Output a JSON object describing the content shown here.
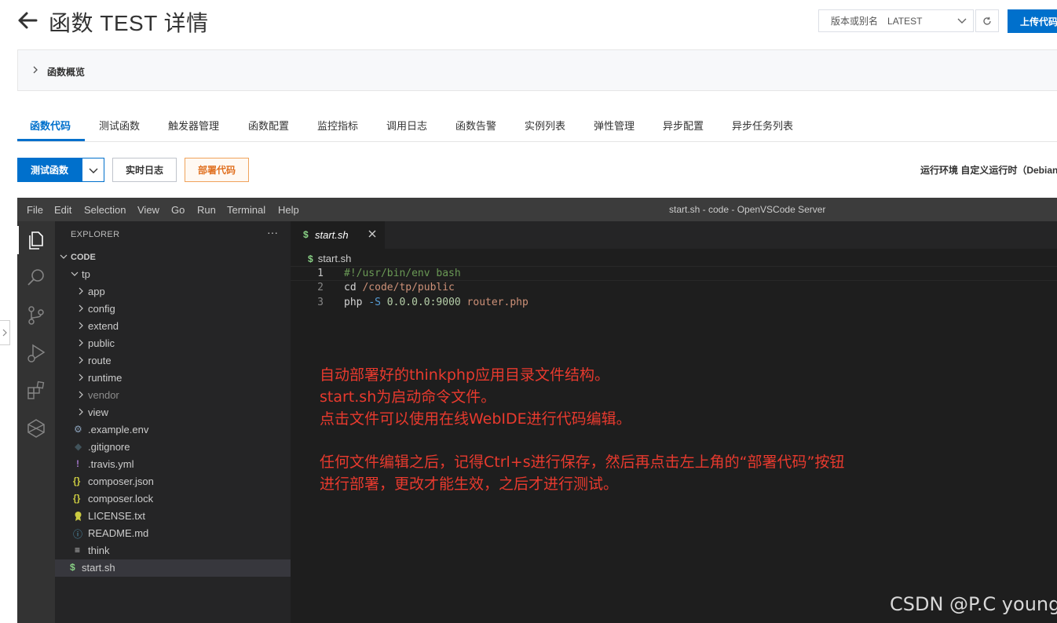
{
  "header": {
    "title": "函数 TEST 详情",
    "version_label": "版本或别名",
    "version_value": "LATEST",
    "upload_label": "上传代码"
  },
  "overview": {
    "label": "函数概览"
  },
  "tabs": [
    {
      "label": "函数代码",
      "active": true
    },
    {
      "label": "测试函数"
    },
    {
      "label": "触发器管理"
    },
    {
      "label": "函数配置"
    },
    {
      "label": "监控指标"
    },
    {
      "label": "调用日志"
    },
    {
      "label": "函数告警"
    },
    {
      "label": "实例列表"
    },
    {
      "label": "弹性管理"
    },
    {
      "label": "异步配置"
    },
    {
      "label": "异步任务列表"
    }
  ],
  "actions": {
    "test_label": "测试函数",
    "log_label": "实时日志",
    "deploy_label": "部署代码",
    "runtime_text": "运行环境 自定义运行时（Debian"
  },
  "ide": {
    "menu": [
      "File",
      "Edit",
      "Selection",
      "View",
      "Go",
      "Run",
      "Terminal",
      "Help"
    ],
    "window_title": "start.sh - code - OpenVSCode Server",
    "explorer_title": "EXPLORER",
    "explorer_more": "···",
    "root_folder": "CODE",
    "tree": [
      {
        "label": "tp",
        "kind": "folder-open",
        "depth": 1
      },
      {
        "label": "app",
        "kind": "folder",
        "depth": 2
      },
      {
        "label": "config",
        "kind": "folder",
        "depth": 2
      },
      {
        "label": "extend",
        "kind": "folder",
        "depth": 2
      },
      {
        "label": "public",
        "kind": "folder",
        "depth": 2
      },
      {
        "label": "route",
        "kind": "folder",
        "depth": 2
      },
      {
        "label": "runtime",
        "kind": "folder",
        "depth": 2
      },
      {
        "label": "vendor",
        "kind": "folder",
        "depth": 2,
        "dim": true
      },
      {
        "label": "view",
        "kind": "folder",
        "depth": 2
      },
      {
        "label": ".example.env",
        "kind": "gear",
        "depth": 2
      },
      {
        "label": ".gitignore",
        "kind": "git",
        "depth": 2
      },
      {
        "label": ".travis.yml",
        "kind": "bang",
        "depth": 2
      },
      {
        "label": "composer.json",
        "kind": "braces",
        "depth": 2
      },
      {
        "label": "composer.lock",
        "kind": "braces",
        "depth": 2
      },
      {
        "label": "LICENSE.txt",
        "kind": "license",
        "depth": 2
      },
      {
        "label": "README.md",
        "kind": "info",
        "depth": 2
      },
      {
        "label": "think",
        "kind": "lines",
        "depth": 2
      },
      {
        "label": "start.sh",
        "kind": "dollar",
        "depth": 1,
        "selected": true
      }
    ],
    "tab_name": "start.sh",
    "breadcrumb": "start.sh",
    "code_lines": [
      "#!/usr/bin/env bash",
      "cd /code/tp/public",
      "php -S 0.0.0.0:9000 router.php"
    ],
    "annotations": [
      "自动部署好的thinkphp应用目录文件结构。",
      "start.sh为启动命令文件。",
      "点击文件可以使用在线WebIDE进行代码编辑。",
      "任何文件编辑之后，记得Ctrl+s进行保存，然后再点击左上角的“部署代码”按钮",
      "进行部署，更改才能生效，之后才进行测试。"
    ]
  },
  "watermark": "CSDN @P.C young",
  "colors": {
    "accent": "#0070cc",
    "deploy": "#e07020",
    "annotation": "#e83a2e",
    "ide_bg": "#1e1e1e"
  }
}
